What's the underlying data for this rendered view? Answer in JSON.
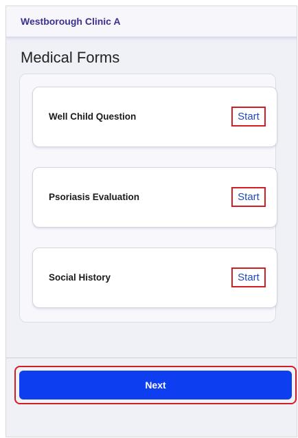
{
  "header": {
    "clinic_name": "Westborough Clinic A"
  },
  "page": {
    "title": "Medical Forms"
  },
  "forms": [
    {
      "name": "Well Child Question",
      "action_label": "Start"
    },
    {
      "name": "Psoriasis Evaluation",
      "action_label": "Start"
    },
    {
      "name": "Social History",
      "action_label": "Start"
    }
  ],
  "footer": {
    "next_label": "Next"
  },
  "colors": {
    "brand_text": "#3a3190",
    "primary_button": "#0d3ef0",
    "link_text": "#2046c0",
    "highlight_outline": "#d21d25"
  }
}
